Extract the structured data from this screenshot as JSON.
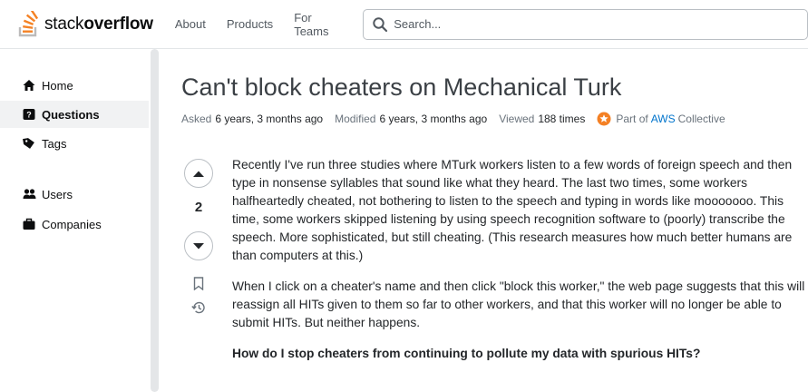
{
  "header": {
    "logo_text_light": "stack",
    "logo_text_bold": "overflow",
    "nav": [
      "About",
      "Products",
      "For Teams"
    ],
    "search_placeholder": "Search..."
  },
  "sidebar": {
    "items": [
      {
        "label": "Home",
        "icon": "home-icon"
      },
      {
        "label": "Questions",
        "icon": "questions-icon",
        "active": true
      },
      {
        "label": "Tags",
        "icon": "tag-icon"
      },
      {
        "label": "Users",
        "icon": "users-icon"
      },
      {
        "label": "Companies",
        "icon": "briefcase-icon"
      }
    ]
  },
  "question": {
    "title": "Can't block cheaters on Mechanical Turk",
    "asked_label": "Asked",
    "asked_value": "6 years, 3 months ago",
    "modified_label": "Modified",
    "modified_value": "6 years, 3 months ago",
    "viewed_label": "Viewed",
    "viewed_value": "188 times",
    "collective_pre": "Part of",
    "collective_link": "AWS",
    "collective_post": "Collective",
    "score": "2",
    "paragraphs": [
      "Recently I've run three studies where MTurk workers listen to a few words of foreign speech and then type in nonsense syllables that sound like what they heard. The last two times, some workers halfheartedly cheated, not bothering to listen to the speech and typing in words like mooooooo. This time, some workers skipped listening by using speech recognition software to (poorly) transcribe the speech. More sophisticated, but still cheating. (This research measures how much better humans are than computers at this.)",
      "When I click on a cheater's name and then click \"block this worker,\" the web page suggests that this will reassign all HITs given to them so far to other workers, and that this worker will no longer be able to submit HITs. But neither happens."
    ],
    "bold_question": "How do I stop cheaters from continuing to pollute my data with spurious HITs?"
  },
  "colors": {
    "brand_orange": "#f48225",
    "link_blue": "#0074cc",
    "aws_orange": "#f48024"
  }
}
